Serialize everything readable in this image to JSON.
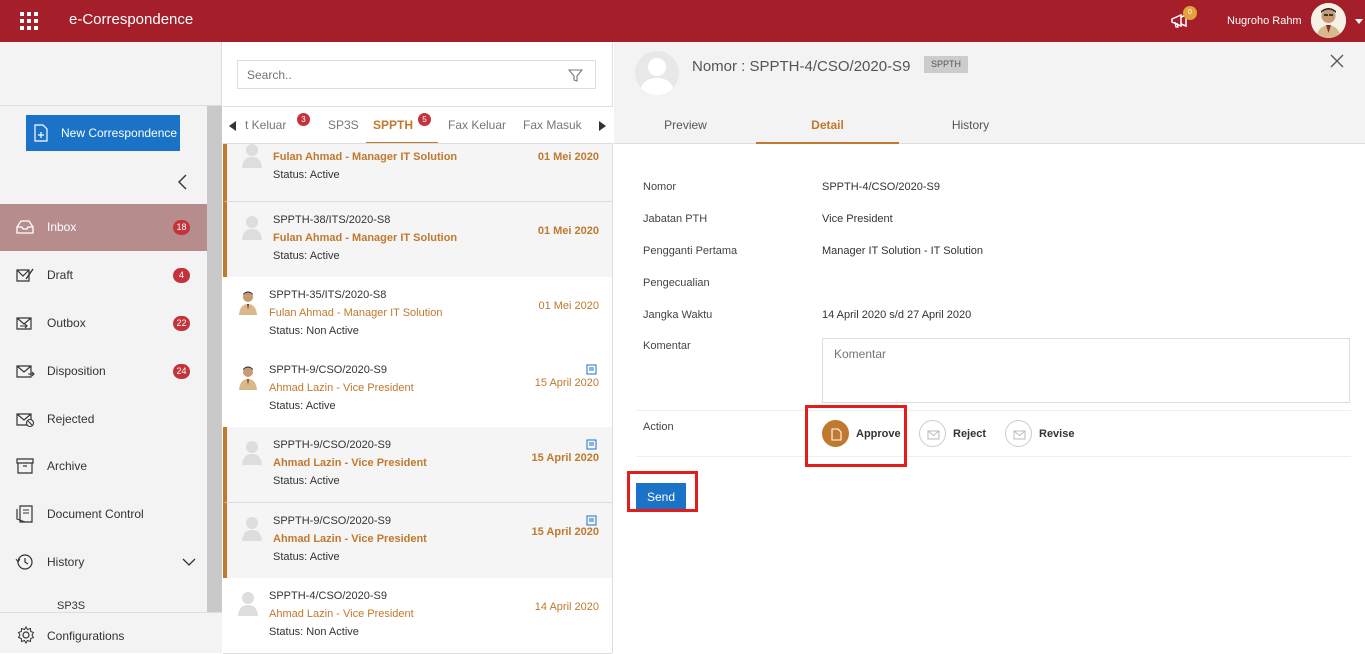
{
  "topbar": {
    "app_title": "e-Correspondence",
    "notification_count": "0",
    "user_name": "Nugroho Rahm"
  },
  "sidebar": {
    "new_button": "New Correspondence",
    "items": [
      {
        "label": "Inbox",
        "badge": "18"
      },
      {
        "label": "Draft",
        "badge": "4"
      },
      {
        "label": "Outbox",
        "badge": "22"
      },
      {
        "label": "Disposition",
        "badge": "24"
      },
      {
        "label": "Rejected",
        "badge": ""
      },
      {
        "label": "Archive",
        "badge": ""
      },
      {
        "label": "Document Control",
        "badge": ""
      },
      {
        "label": "History",
        "badge": ""
      }
    ],
    "sub_item": "SP3S",
    "configurations": "Configurations"
  },
  "list": {
    "search_placeholder": "Search..",
    "tabs": [
      {
        "label": "t Keluar",
        "badge": "3"
      },
      {
        "label": "SP3S",
        "badge": ""
      },
      {
        "label": "SPPTH",
        "badge": "5"
      },
      {
        "label": "Fax Keluar",
        "badge": ""
      },
      {
        "label": "Fax Masuk",
        "badge": ""
      }
    ],
    "items": [
      {
        "title": "",
        "sender": "Fulan Ahmad - Manager IT Solution",
        "status": "Status: Active",
        "date": "01 Mei 2020"
      },
      {
        "title": "SPPTH-38/ITS/2020-S8",
        "sender": "Fulan Ahmad - Manager IT Solution",
        "status": "Status: Active",
        "date": "01 Mei 2020"
      },
      {
        "title": "SPPTH-35/ITS/2020-S8",
        "sender": "Fulan Ahmad - Manager IT Solution",
        "status": "Status: Non Active",
        "date": "01 Mei 2020"
      },
      {
        "title": "SPPTH-9/CSO/2020-S9",
        "sender": "Ahmad Lazin - Vice President",
        "status": "Status: Active",
        "date": "15 April 2020"
      },
      {
        "title": "SPPTH-9/CSO/2020-S9",
        "sender": "Ahmad Lazin - Vice President",
        "status": "Status: Active",
        "date": "15 April 2020"
      },
      {
        "title": "SPPTH-9/CSO/2020-S9",
        "sender": "Ahmad Lazin - Vice President",
        "status": "Status: Active",
        "date": "15 April 2020"
      },
      {
        "title": "SPPTH-4/CSO/2020-S9",
        "sender": "Ahmad Lazin - Vice President",
        "status": "Status: Non Active",
        "date": "14 April 2020"
      }
    ]
  },
  "detail": {
    "title": "Nomor : SPPTH-4/CSO/2020-S9",
    "badge": "SPPTH",
    "tabs": [
      "Preview",
      "Detail",
      "History"
    ],
    "fields": [
      {
        "label": "Nomor",
        "value": "SPPTH-4/CSO/2020-S9"
      },
      {
        "label": "Jabatan PTH",
        "value": "Vice President"
      },
      {
        "label": "Pengganti Pertama",
        "value": "Manager IT Solution - IT Solution"
      },
      {
        "label": "Pengecualian",
        "value": ""
      },
      {
        "label": "Jangka Waktu",
        "value": "14 April 2020 s/d 27 April 2020"
      },
      {
        "label": "Komentar",
        "value": ""
      },
      {
        "label": "Action",
        "value": ""
      }
    ],
    "comment_placeholder": "Komentar",
    "actions": [
      "Approve",
      "Reject",
      "Revise"
    ],
    "send_label": "Send"
  },
  "colors": {
    "brand": "#a41f2a",
    "accent": "#c0792f",
    "primary_button": "#1a73c6",
    "badge": "#c4333b",
    "highlight": "#e31c1c"
  }
}
